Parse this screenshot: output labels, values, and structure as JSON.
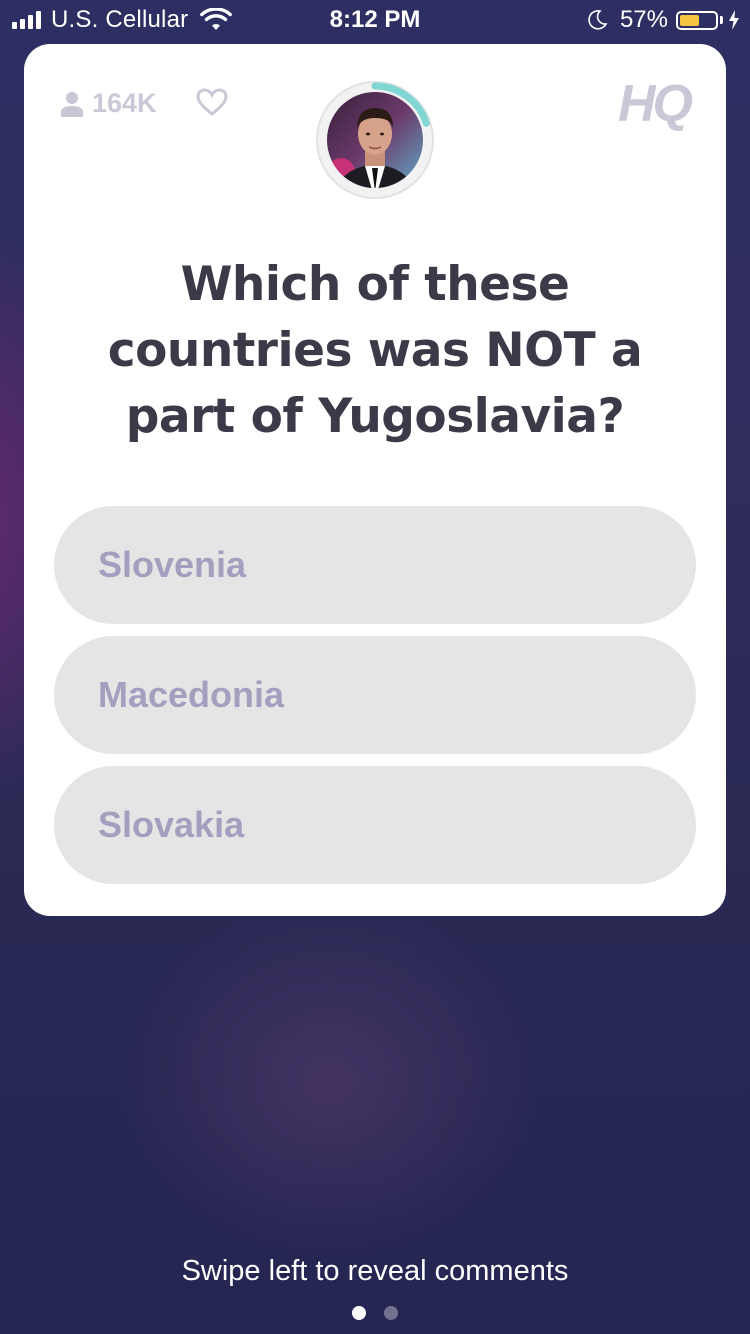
{
  "status_bar": {
    "carrier": "U.S. Cellular",
    "time": "8:12 PM",
    "battery_percent": "57%",
    "battery_level": 0.57,
    "icons": [
      "signal-icon",
      "wifi-icon",
      "moon-icon",
      "battery-icon",
      "charging-bolt-icon"
    ]
  },
  "card": {
    "viewer_count": "164K",
    "logo": "HQ",
    "question": "Which of these countries was NOT a part of Yugoslavia?",
    "answers": [
      {
        "label": "Slovenia"
      },
      {
        "label": "Macedonia"
      },
      {
        "label": "Slovakia"
      }
    ],
    "timer_progress": 0.2
  },
  "footer": {
    "hint": "Swipe left to reveal comments",
    "page_count": 2,
    "active_page": 0
  },
  "colors": {
    "accent_timer": "#7fd6d2",
    "answer_bg": "#e5e5e5",
    "answer_text": "#a3a0bf",
    "question_text": "#3b3a48",
    "background": "#2d2f63"
  }
}
